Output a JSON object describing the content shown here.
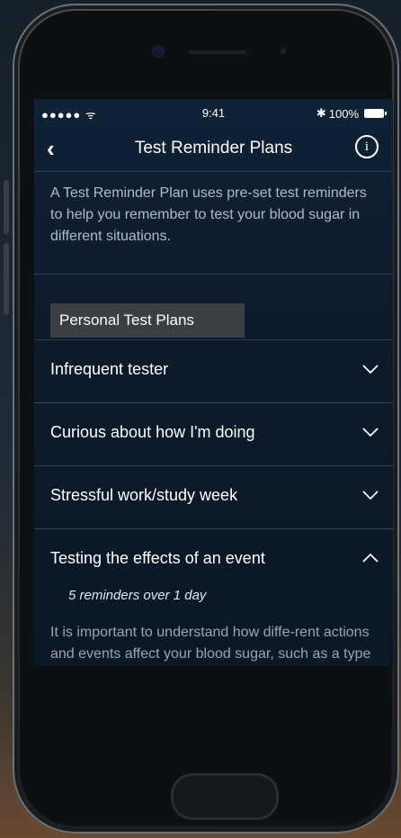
{
  "status_bar": {
    "signal": "●●●●● ᯤ",
    "time": "9:41",
    "bluetooth": "✱",
    "battery_text": "100%"
  },
  "nav": {
    "back_glyph": "‹",
    "title": "Test Reminder Plans",
    "info_glyph": "i"
  },
  "intro_text": "A Test Reminder Plan uses pre-set test reminders to help you remember to test your blood sugar in different situations.",
  "section_title": "Personal Test Plans",
  "plans": [
    {
      "label": "Infrequent tester",
      "expanded": false
    },
    {
      "label": "Curious about how I'm doing",
      "expanded": false
    },
    {
      "label": "Stressful work/study week",
      "expanded": false
    },
    {
      "label": "Testing the effects of an event",
      "expanded": true
    }
  ],
  "expanded_plan": {
    "subtitle": "5 reminders over 1 day",
    "description": "It is important to understand how diffe-rent actions and events affect your blood sugar, such as a type of food, a certain exercise, or an event."
  },
  "colors": {
    "screen_bg": "#0f2236",
    "section_bg": "#3b3f44",
    "text_muted": "#9aa6b3"
  }
}
